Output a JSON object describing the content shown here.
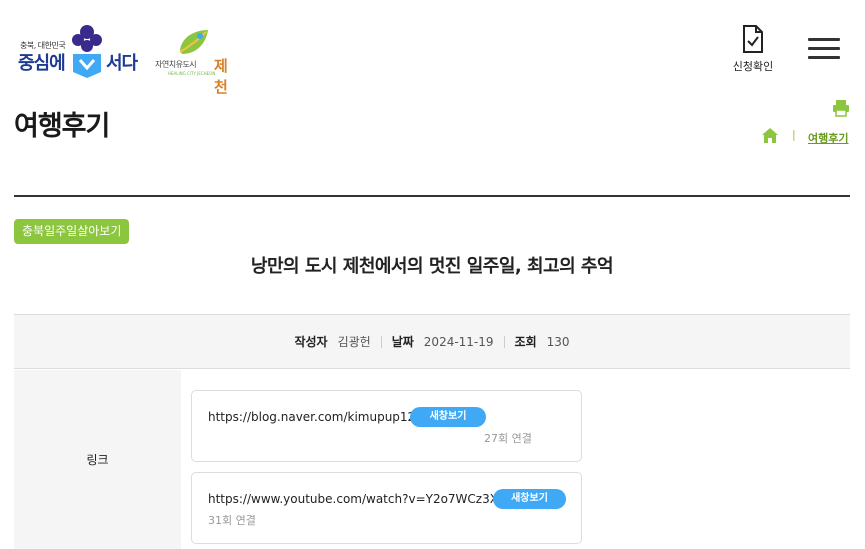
{
  "header": {
    "logo_primary": {
      "small_text": "충북, 대한민국",
      "text_left": "중심에",
      "text_right": "서다"
    },
    "logo_secondary": {
      "text_small": "자연치유도시",
      "text_brand": "제천",
      "text_en": "HEALING CITY JECHEON"
    },
    "confirm_label": "신청확인",
    "menu_icon": "hamburger-menu-icon"
  },
  "page": {
    "title": "여행후기",
    "breadcrumb": {
      "home_icon": "home-icon",
      "separator": "|",
      "current": "여행후기"
    },
    "print_icon": "print-icon"
  },
  "post": {
    "category": "충북일주일살아보기",
    "title": "낭만의 도시 제천에서의 멋진 일주일, 최고의 추억",
    "meta": [
      {
        "label": "작성자",
        "value": "김광헌"
      },
      {
        "label": "날짜",
        "value": "2024-11-19"
      },
      {
        "label": "조회",
        "value": "130"
      }
    ],
    "links_label": "링크",
    "links": [
      {
        "url": "https://blog.naver.com/kimupup1217",
        "button": "새창보기",
        "count": "27회 연결"
      },
      {
        "url": "https://www.youtube.com/watch?v=Y2o7WCz3Xno",
        "button": "새창보기",
        "count": "31회 연결"
      }
    ]
  },
  "colors": {
    "brand_navy": "#1f3a93",
    "accent_green": "#8cc63f",
    "button_blue": "#3fa9f5"
  }
}
